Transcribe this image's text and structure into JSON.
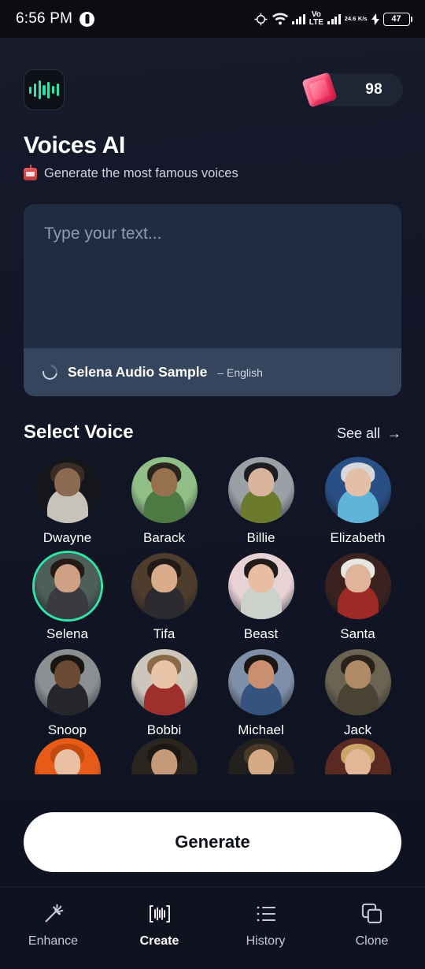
{
  "statusbar": {
    "time": "6:56 PM",
    "left_icon": "app-notification-icon",
    "icons": [
      "location-crosshair-icon",
      "wifi-icon",
      "signal-bars-icon",
      "signal-bars-icon",
      "charging-bolt-icon"
    ],
    "volte_top": "Vo",
    "volte_bottom": "LTE",
    "net_speed_value": "24.6",
    "net_speed_unit": "K/s",
    "battery_level": "47"
  },
  "header": {
    "logo_icon": "audio-waveform-icon",
    "credits_icon": "gem-diamond-icon",
    "credits": "98"
  },
  "app": {
    "title": "Voices AI",
    "subtitle_icon": "robot-icon",
    "subtitle": "Generate the most famous voices"
  },
  "input": {
    "placeholder": "Type your text...",
    "value": "",
    "sample_icon": "loading-spinner-icon",
    "sample_name": "Selena Audio Sample",
    "sample_language": "– English"
  },
  "voice_section": {
    "title": "Select Voice",
    "see_all": "See all",
    "see_all_arrow": "→",
    "voices": [
      {
        "name": "Dwayne",
        "selected": false,
        "bg": "#14161c",
        "skin": "#8c6a52",
        "hair": "#3a2d26",
        "cloth": "#c8c3b8"
      },
      {
        "name": "Barack",
        "selected": false,
        "bg": "#8fbe86",
        "skin": "#96704f",
        "hair": "#2a2420",
        "cloth": "#4c7a42"
      },
      {
        "name": "Billie",
        "selected": false,
        "bg": "#9ba0a6",
        "skin": "#d8b49c",
        "hair": "#1c1c22",
        "cloth": "#6b7a2c"
      },
      {
        "name": "Elizabeth",
        "selected": false,
        "bg": "#2a4f85",
        "skin": "#e2bfa6",
        "hair": "#d8d8dc",
        "cloth": "#5fb4d8"
      },
      {
        "name": "Selena",
        "selected": true,
        "bg": "#4d5f58",
        "skin": "#cfa084",
        "hair": "#241a16",
        "cloth": "#3a3a40"
      },
      {
        "name": "Tifa",
        "selected": false,
        "bg": "#4e3c2d",
        "skin": "#d9ab8a",
        "hair": "#221a18",
        "cloth": "#2d2a30"
      },
      {
        "name": "Beast",
        "selected": false,
        "bg": "#e7d2d6",
        "skin": "#e8bda2",
        "hair": "#221c1a",
        "cloth": "#ccd2cb"
      },
      {
        "name": "Santa",
        "selected": false,
        "bg": "#3b2220",
        "skin": "#e0b49a",
        "hair": "#e8e6e2",
        "cloth": "#9e2a26"
      },
      {
        "name": "Snoop",
        "selected": false,
        "bg": "#8b8f92",
        "skin": "#6b4a35",
        "hair": "#191513",
        "cloth": "#24262b"
      },
      {
        "name": "Bobbi",
        "selected": false,
        "bg": "#cdc6bd",
        "skin": "#e8c4a8",
        "hair": "#8a6a48",
        "cloth": "#9e2f2c"
      },
      {
        "name": "Michael",
        "selected": false,
        "bg": "#7f8faa",
        "skin": "#c98f6e",
        "hair": "#1b1613",
        "cloth": "#36527e"
      },
      {
        "name": "Jack",
        "selected": false,
        "bg": "#6b6452",
        "skin": "#b08a66",
        "hair": "#2a211c",
        "cloth": "#4a4334"
      }
    ],
    "partial_row": [
      {
        "name": "",
        "bg": "#e85a18",
        "skin": "#e9c0a4",
        "hair": "#c44a10",
        "cloth": "#e85a18"
      },
      {
        "name": "",
        "bg": "#2b2520",
        "skin": "#c49a78",
        "hair": "#1e1814",
        "cloth": "#2a2320"
      },
      {
        "name": "",
        "bg": "#23201e",
        "skin": "#d5aa86",
        "hair": "#4a3a28",
        "cloth": "#1e1a18"
      },
      {
        "name": "",
        "bg": "#5a2a22",
        "skin": "#e0b898",
        "hair": "#caa56a",
        "cloth": "#3a1f1a"
      }
    ]
  },
  "actions": {
    "generate": "Generate"
  },
  "navbar": {
    "items": [
      {
        "label": "Enhance",
        "icon": "magic-wand-icon",
        "active": false
      },
      {
        "label": "Create",
        "icon": "waveform-scan-icon",
        "active": true
      },
      {
        "label": "History",
        "icon": "list-icon",
        "active": false
      },
      {
        "label": "Clone",
        "icon": "copy-layers-icon",
        "active": false
      }
    ]
  },
  "colors": {
    "accent": "#2ee6a8",
    "page_bg": "#141726",
    "card_bg": "#202c42",
    "sample_bg": "#35455d",
    "gem": "#ff4d73"
  }
}
